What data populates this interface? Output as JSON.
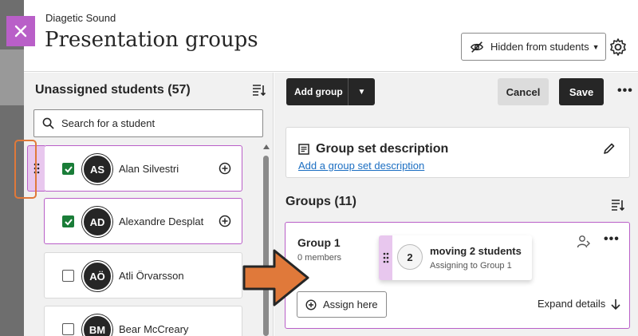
{
  "header": {
    "course_name": "Diagetic Sound",
    "title": "Presentation groups",
    "visibility_label": "Hidden from students",
    "close_icon": "close-icon",
    "settings_icon": "gear-icon"
  },
  "unassigned": {
    "title": "Unassigned students (57)",
    "search_placeholder": "Search for a student",
    "students": [
      {
        "initials": "AS",
        "name": "Alan Silvestri",
        "checked": true,
        "selected": true
      },
      {
        "initials": "AD",
        "name": "Alexandre Desplat",
        "checked": true,
        "selected": true
      },
      {
        "initials": "AÖ",
        "name": "Atli Örvarsson",
        "checked": false,
        "selected": false
      },
      {
        "initials": "BM",
        "name": "Bear McCreary",
        "checked": false,
        "selected": false
      }
    ]
  },
  "toolbar": {
    "add_group_label": "Add group",
    "cancel_label": "Cancel",
    "save_label": "Save",
    "more_label": "•••"
  },
  "description": {
    "title": "Group set description",
    "link": "Add a group set description"
  },
  "groups": {
    "title": "Groups (11)",
    "items": [
      {
        "name": "Group 1",
        "members": "0 members",
        "assign_label": "Assign here",
        "expand_label": "Expand details"
      }
    ]
  },
  "drag_ghost": {
    "count": "2",
    "title": "moving 2 students",
    "subtitle": "Assigning to Group 1"
  },
  "colors": {
    "accent_purple": "#b95fc8",
    "check_green": "#1a7d38",
    "arrow_orange": "#e0793a",
    "link_blue": "#1b6ec2"
  }
}
